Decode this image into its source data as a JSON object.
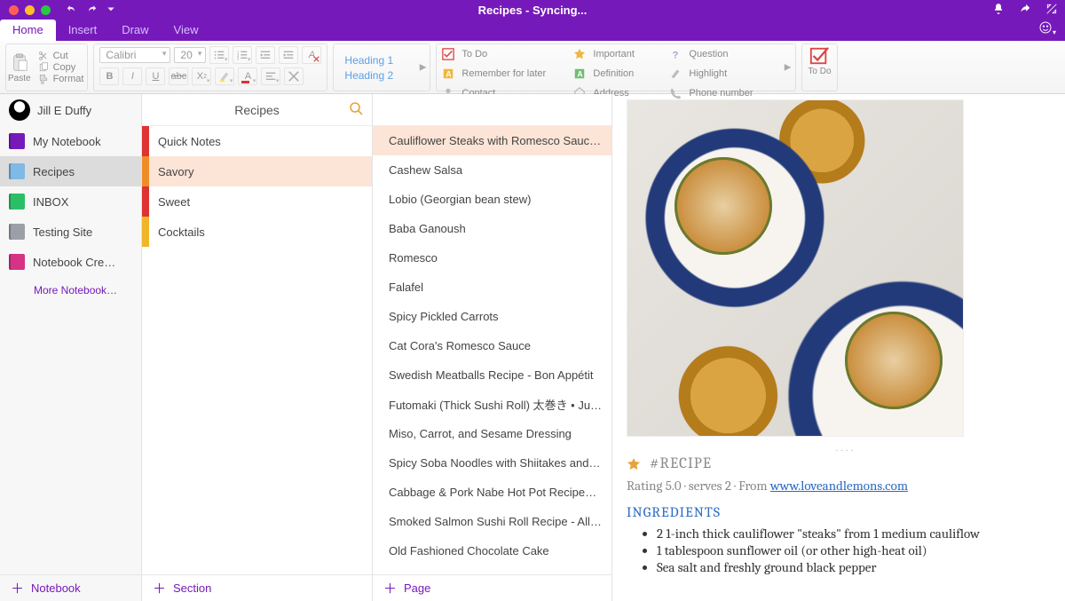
{
  "app": {
    "title": "Recipes - Syncing..."
  },
  "menubar": {
    "tabs": [
      "Home",
      "Insert",
      "Draw",
      "View"
    ],
    "active": 0
  },
  "ribbon": {
    "paste": "Paste",
    "clipitems": [
      "Cut",
      "Copy",
      "Format"
    ],
    "font": "Calibri",
    "size": "20",
    "styles": [
      "Heading 1",
      "Heading 2"
    ],
    "tags": [
      {
        "label": "To Do",
        "icon": "todo"
      },
      {
        "label": "Important",
        "icon": "star"
      },
      {
        "label": "Question",
        "icon": "question"
      },
      {
        "label": "Remember for later",
        "icon": "remember"
      },
      {
        "label": "Definition",
        "icon": "definition"
      },
      {
        "label": "Highlight",
        "icon": "highlight"
      },
      {
        "label": "Contact",
        "icon": "contact"
      },
      {
        "label": "Address",
        "icon": "address"
      },
      {
        "label": "Phone number",
        "icon": "phone"
      }
    ],
    "todo": "To Do"
  },
  "sidebar": {
    "user": "Jill E Duffy",
    "notebooks": [
      {
        "label": "My Notebook",
        "color": "#7619ba"
      },
      {
        "label": "Recipes",
        "color": "#7fb9e6",
        "selected": true
      },
      {
        "label": "INBOX",
        "color": "#2bbf65"
      },
      {
        "label": "Testing Site",
        "color": "#9aa0a6"
      },
      {
        "label": "Notebook Cre…",
        "color": "#d63384"
      }
    ],
    "more": "More Notebook…",
    "add": "Notebook"
  },
  "sections": {
    "header": "Recipes",
    "items": [
      {
        "label": "Quick Notes",
        "color": "#d33"
      },
      {
        "label": "Savory",
        "color": "#f08c28",
        "selected": true
      },
      {
        "label": "Sweet",
        "color": "#d33"
      },
      {
        "label": "Cocktails",
        "color": "#f0b528"
      }
    ],
    "add": "Section"
  },
  "pages": {
    "items": [
      "Cauliflower Steaks with Romesco Sauc…",
      "Cashew Salsa",
      "Lobio (Georgian bean stew)",
      "Baba Ganoush",
      "Romesco",
      "Falafel",
      "Spicy Pickled Carrots",
      "Cat Cora's Romesco Sauce",
      "Swedish Meatballs Recipe - Bon Appétit",
      "Futomaki (Thick Sushi Roll) 太巻き • Ju…",
      "Miso, Carrot, and Sesame Dressing",
      "Spicy Soba Noodles with Shiitakes and…",
      "Cabbage & Pork Nabe Hot Pot Recipe…",
      "Smoked Salmon Sushi Roll Recipe - All…",
      "Old Fashioned Chocolate Cake"
    ],
    "selected": 0,
    "add": "Page"
  },
  "content": {
    "tag": "#RECIPE",
    "rating_prefix": "Rating 5.0 · serves 2 · From ",
    "rating_link": "www.loveandlemons.com",
    "ing_title": "INGREDIENTS",
    "ingredients": [
      "2 1-inch thick cauliflower \"steaks\" from 1 medium cauliflow",
      "1 tablespoon sunflower oil (or other high-heat oil)",
      "Sea salt and freshly ground black pepper"
    ]
  }
}
